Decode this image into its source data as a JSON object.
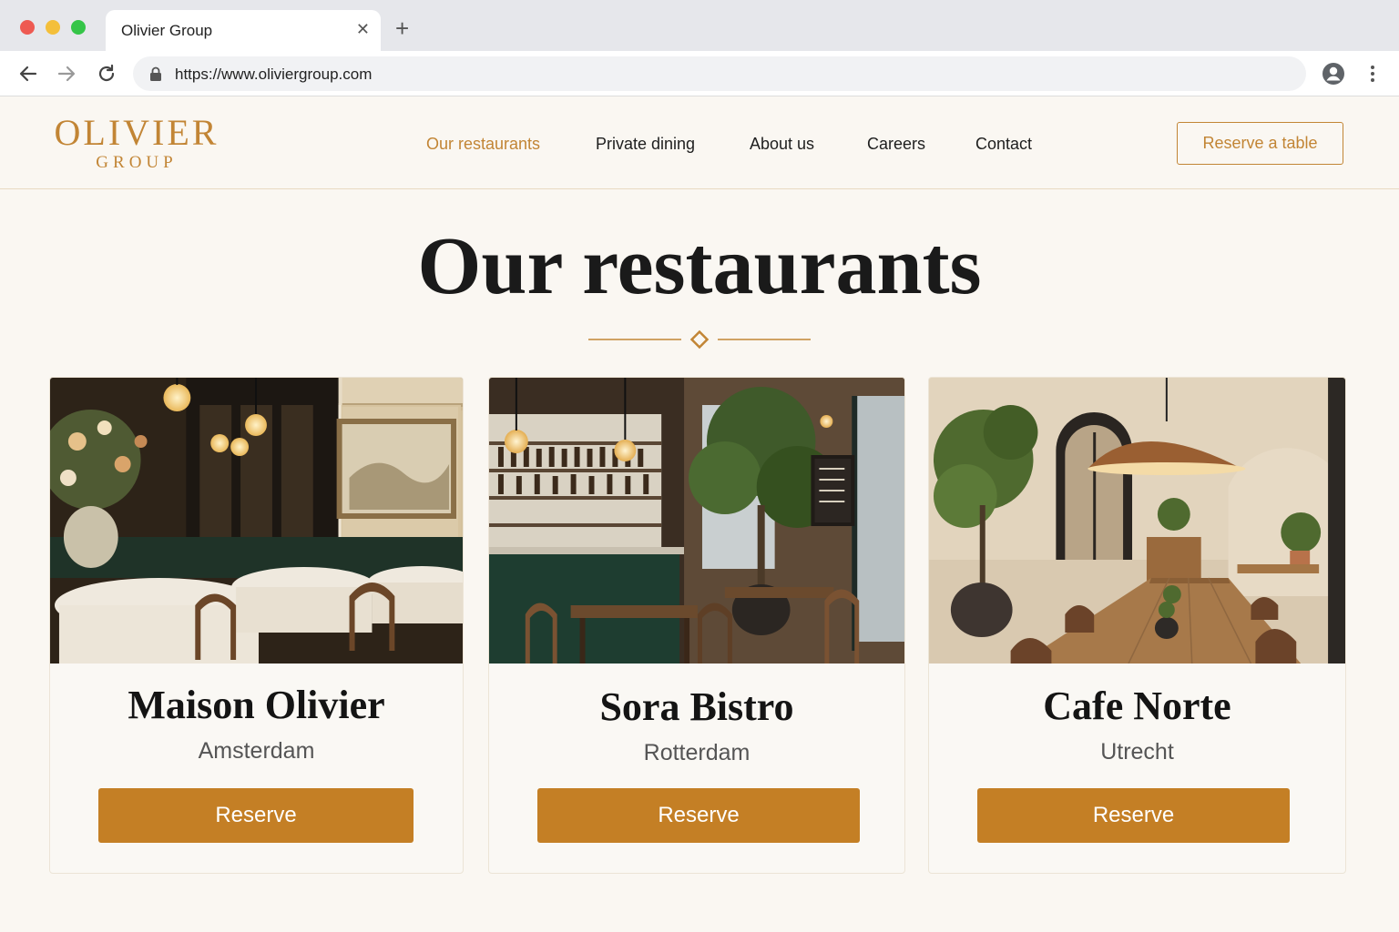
{
  "browser": {
    "tab_title": "Olivier Group",
    "url": "https://www.oliviergroup.com",
    "icons": [
      "back-icon",
      "forward-icon",
      "reload-icon",
      "lock-icon",
      "profile-icon",
      "kebab-menu-icon",
      "close-icon",
      "plus-icon"
    ]
  },
  "header": {
    "logo_main": "OLIVIER",
    "logo_sub": "GROUP",
    "nav": [
      "Our restaurants",
      "Private dining",
      "About us",
      "Careers",
      "Contact"
    ],
    "active_nav": "Our restaurants",
    "cta": "Reserve a table"
  },
  "main": {
    "title": "Our restaurants",
    "restaurants": [
      {
        "name": "Maison Olivier",
        "city": "Amsterdam",
        "button": "Reserve"
      },
      {
        "name": "Sora Bistro",
        "city": "Rotterdam",
        "button": "Reserve"
      },
      {
        "name": "Cafe Norte",
        "city": "Utrecht",
        "button": "Reserve"
      }
    ]
  },
  "colors": {
    "accent": "#c28535",
    "button": "#c47f25",
    "background": "#faf7f2",
    "text": "#1a1a1a"
  }
}
